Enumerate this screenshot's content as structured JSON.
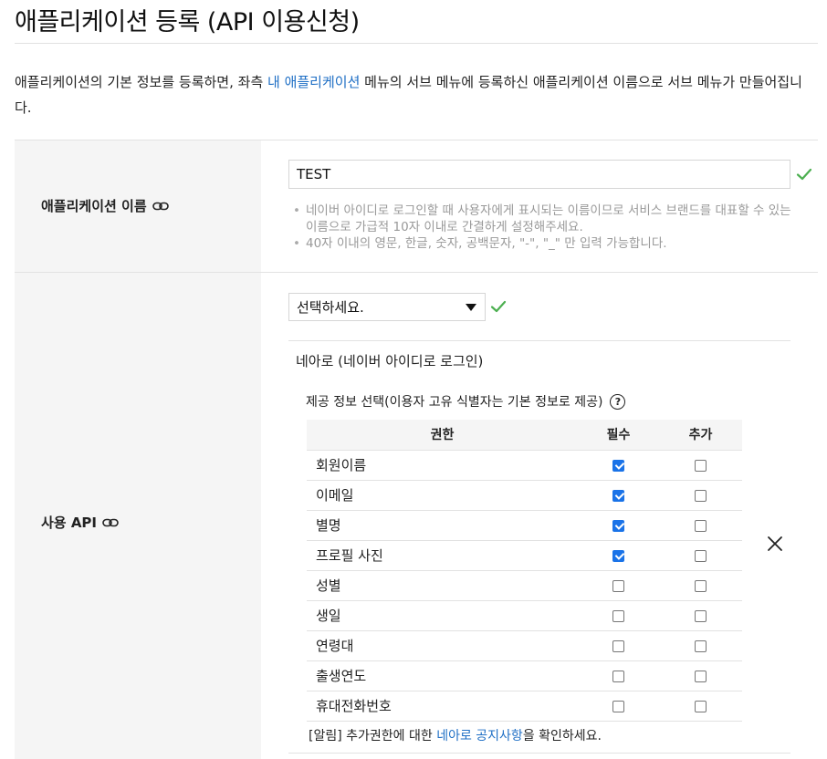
{
  "page_title": "애플리케이션 등록 (API 이용신청)",
  "intro": {
    "before": "애플리케이션의 기본 정보를 등록하면, 좌측 ",
    "link": "내 애플리케이션",
    "after": " 메뉴의 서브 메뉴에 등록하신 애플리케이션 이름으로 서브 메뉴가 만들어집니다."
  },
  "app_name": {
    "label": "애플리케이션 이름",
    "label_icon": "link-icon",
    "value": "TEST",
    "status_icon": "check-icon",
    "hints": [
      "네이버 아이디로 로그인할 때 사용자에게 표시되는 이름이므로 서비스 브랜드를 대표할 수 있는 이름으로 가급적 10자 이내로 간결하게 설정해주세요.",
      "40자 이내의 영문, 한글, 숫자, 공백문자, \"-\", \"_\" 만 입력 가능합니다."
    ]
  },
  "api": {
    "label": "사용 API",
    "label_icon": "link-icon",
    "select_value": "선택하세요.",
    "select_icon": "triangle-down-icon",
    "status_icon": "check-icon",
    "panel": {
      "name": "네아로 (네이버 아이디로 로그인)",
      "info_title": "제공 정보 선택(이용자 고유 식별자는 기본 정보로 제공)",
      "help_icon_text": "?",
      "columns": [
        "권한",
        "필수",
        "추가"
      ],
      "rows": [
        {
          "name": "회원이름",
          "required": true,
          "additional": false
        },
        {
          "name": "이메일",
          "required": true,
          "additional": false
        },
        {
          "name": "별명",
          "required": true,
          "additional": false
        },
        {
          "name": "프로필 사진",
          "required": true,
          "additional": false
        },
        {
          "name": "성별",
          "required": false,
          "additional": false
        },
        {
          "name": "생일",
          "required": false,
          "additional": false
        },
        {
          "name": "연령대",
          "required": false,
          "additional": false
        },
        {
          "name": "출생연도",
          "required": false,
          "additional": false
        },
        {
          "name": "휴대전화번호",
          "required": false,
          "additional": false
        }
      ],
      "notice": {
        "before": "[알림] 추가권한에 대한 ",
        "link": "네아로 공지사항",
        "after": "을 확인하세요."
      },
      "close_icon": "close-icon"
    }
  },
  "colors": {
    "link": "#1f6fc5",
    "check": "#4caf50",
    "checkbox_on": "#1a73e8",
    "label_bg": "#f5f5f5"
  }
}
